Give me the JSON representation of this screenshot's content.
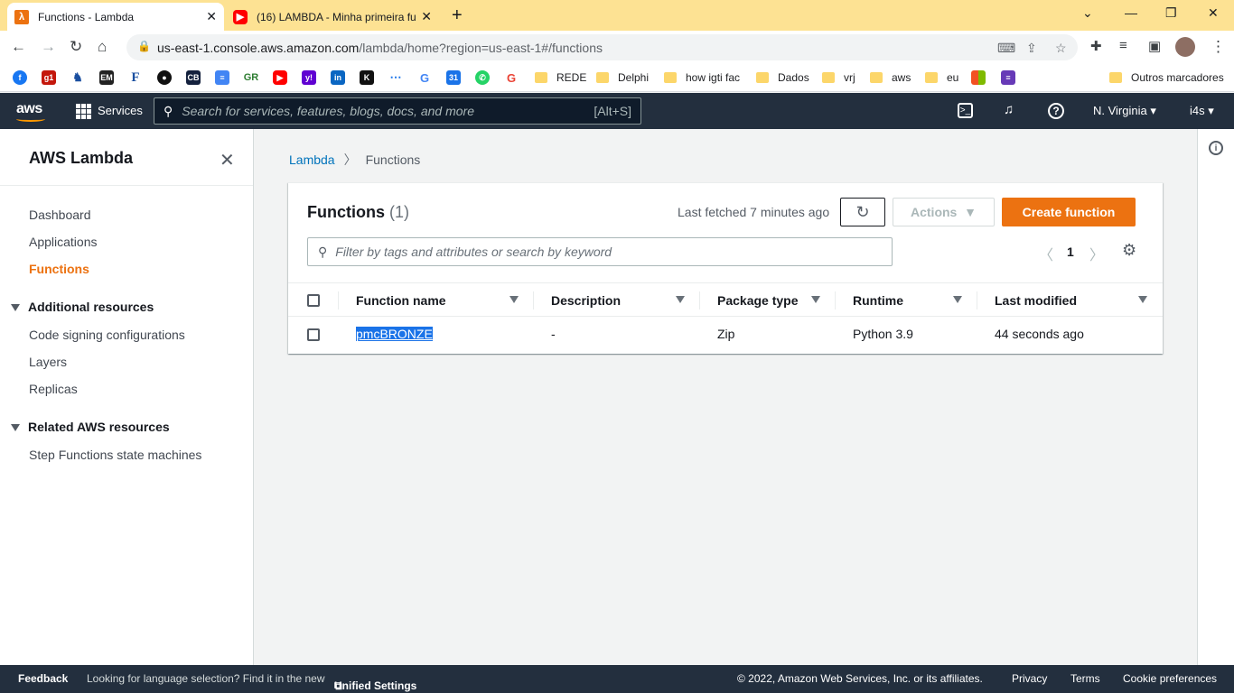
{
  "browser": {
    "tabs": [
      {
        "title": "Functions - Lambda",
        "active": true
      },
      {
        "title": "(16) LAMBDA - Minha primeira fu",
        "active": false
      }
    ],
    "url_host": "us-east-1.console.aws.amazon.com",
    "url_rest": "/lambda/home?region=us-east-1#/functions",
    "bookmarks": {
      "rede": "REDE",
      "delphi": "Delphi",
      "how_igti": "how igti fac",
      "dados": "Dados",
      "vrj": "vrj",
      "aws": "aws",
      "eu": "eu",
      "outros": "Outros marcadores"
    },
    "bookmark_icons": {
      "g1": "g1",
      "em": "EM",
      "f": "F",
      "cb": "CB",
      "gr": "GR",
      "cal": "31",
      "y": "y!",
      "in": "in",
      "k": "K",
      "g": "G"
    }
  },
  "aws_nav": {
    "logo": "aws",
    "services": "Services",
    "search_placeholder": "Search for services, features, blogs, docs, and more",
    "search_shortcut": "[Alt+S]",
    "region": "N. Virginia",
    "account": "i4s"
  },
  "sidebar": {
    "title": "AWS Lambda",
    "links": {
      "dashboard": "Dashboard",
      "applications": "Applications",
      "functions": "Functions"
    },
    "additional_title": "Additional resources",
    "additional": {
      "code_signing": "Code signing configurations",
      "layers": "Layers",
      "replicas": "Replicas"
    },
    "related_title": "Related AWS resources",
    "related": {
      "step_functions": "Step Functions state machines"
    }
  },
  "breadcrumb": {
    "root": "Lambda",
    "current": "Functions"
  },
  "functions_panel": {
    "title": "Functions",
    "count": "(1)",
    "last_fetched": "Last fetched 7 minutes ago",
    "actions": "Actions",
    "create": "Create function",
    "filter_placeholder": "Filter by tags and attributes or search by keyword",
    "page": "1",
    "columns": {
      "name": "Function name",
      "description": "Description",
      "package": "Package type",
      "runtime": "Runtime",
      "modified": "Last modified"
    },
    "rows": [
      {
        "name": "pmcBRONZE",
        "description": "-",
        "package": "Zip",
        "runtime": "Python 3.9",
        "modified": "44 seconds ago"
      }
    ]
  },
  "footer": {
    "feedback": "Feedback",
    "lang_text": "Looking for language selection? Find it in the new",
    "unified": "Unified Settings",
    "copyright": "© 2022, Amazon Web Services, Inc. or its affiliates.",
    "privacy": "Privacy",
    "terms": "Terms",
    "cookies": "Cookie preferences"
  }
}
